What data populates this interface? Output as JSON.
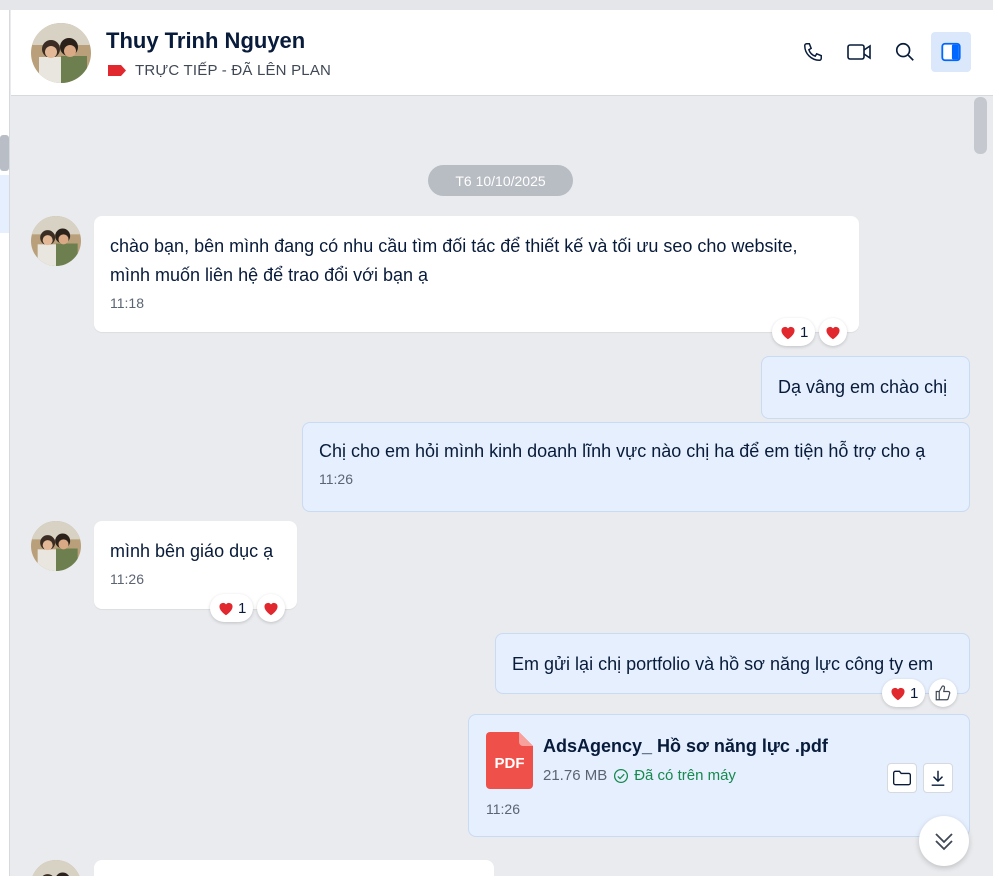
{
  "header": {
    "contact_name": "Thuy Trinh Nguyen",
    "status_label": "TRỰC TIẾP - ĐÃ LÊN PLAN",
    "status_color": "#e0282e",
    "actions": [
      "phone-icon",
      "video-icon",
      "search-icon",
      "sidebar-toggle-icon"
    ]
  },
  "chat": {
    "date_divider": "T6 10/10/2025",
    "messages": [
      {
        "direction": "incoming",
        "text_line1": "chào bạn, bên mình đang có nhu cầu tìm đối tác để thiết kế và tối ưu seo cho website,",
        "text_line2": "mình muốn liên hệ để trao đổi với bạn ạ",
        "time": "11:18",
        "reaction_icon": "heart",
        "reaction_count": "1"
      },
      {
        "direction": "outgoing",
        "text": "Dạ vâng em chào chị"
      },
      {
        "direction": "outgoing",
        "text": "Chị cho em hỏi mình kinh doanh lĩnh vực nào chị ha để em tiện hỗ trợ cho ạ",
        "time": "11:26"
      },
      {
        "direction": "incoming",
        "text": "mình bên giáo dục ạ",
        "time": "11:26",
        "reaction_icon": "heart",
        "reaction_count": "1"
      },
      {
        "direction": "outgoing",
        "text": "Em gửi lại chị portfolio và hồ sơ năng lực công ty em",
        "reaction_icon": "heart",
        "reaction_count": "1"
      },
      {
        "direction": "outgoing",
        "type": "file",
        "file_type": "PDF",
        "file_name": "AdsAgency_ Hồ sơ năng lực .pdf",
        "file_size": "21.76 MB",
        "file_status": "Đã có trên máy",
        "time": "11:26"
      }
    ]
  },
  "colors": {
    "outgoing_bubble": "#e5effd",
    "incoming_bubble": "#ffffff",
    "accent": "#0068ff",
    "heart": "#e0282e",
    "success": "#17894f"
  }
}
